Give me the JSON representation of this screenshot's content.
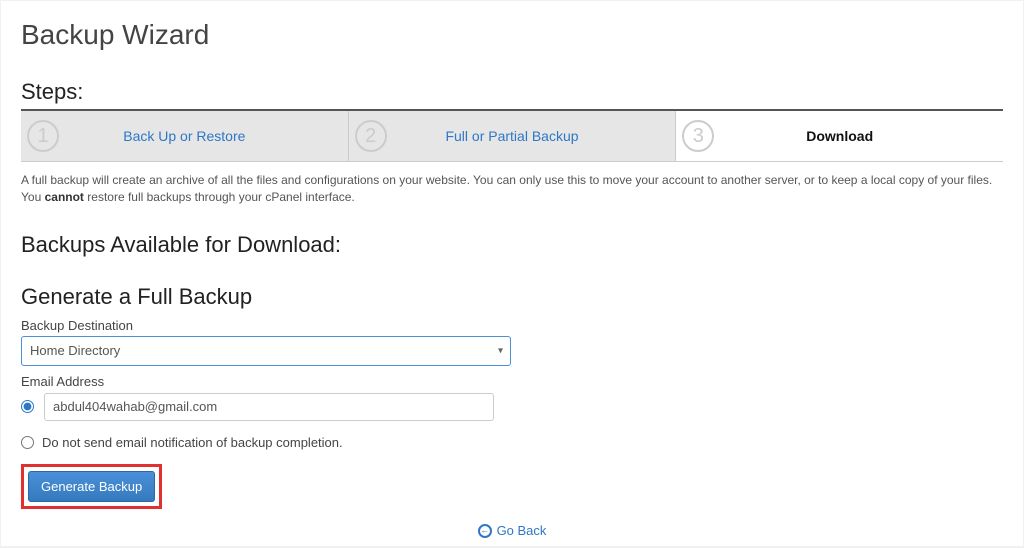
{
  "page_title": "Backup Wizard",
  "steps_heading": "Steps:",
  "steps": [
    {
      "num": "1",
      "label": "Back Up or Restore"
    },
    {
      "num": "2",
      "label": "Full or Partial Backup"
    },
    {
      "num": "3",
      "label": "Download"
    }
  ],
  "info_text_pre": "A full backup will create an archive of all the files and configurations on your website. You can only use this to move your account to another server, or to keep a local copy of your files. You ",
  "info_text_bold": "cannot",
  "info_text_post": " restore full backups through your cPanel interface.",
  "downloads_heading": "Backups Available for Download:",
  "generate_heading": "Generate a Full Backup",
  "dest_label": "Backup Destination",
  "dest_value": "Home Directory",
  "email_label": "Email Address",
  "email_value": "abdul404wahab@gmail.com",
  "no_email_text": "Do not send email notification of backup completion.",
  "generate_btn": "Generate Backup",
  "go_back": "Go Back"
}
